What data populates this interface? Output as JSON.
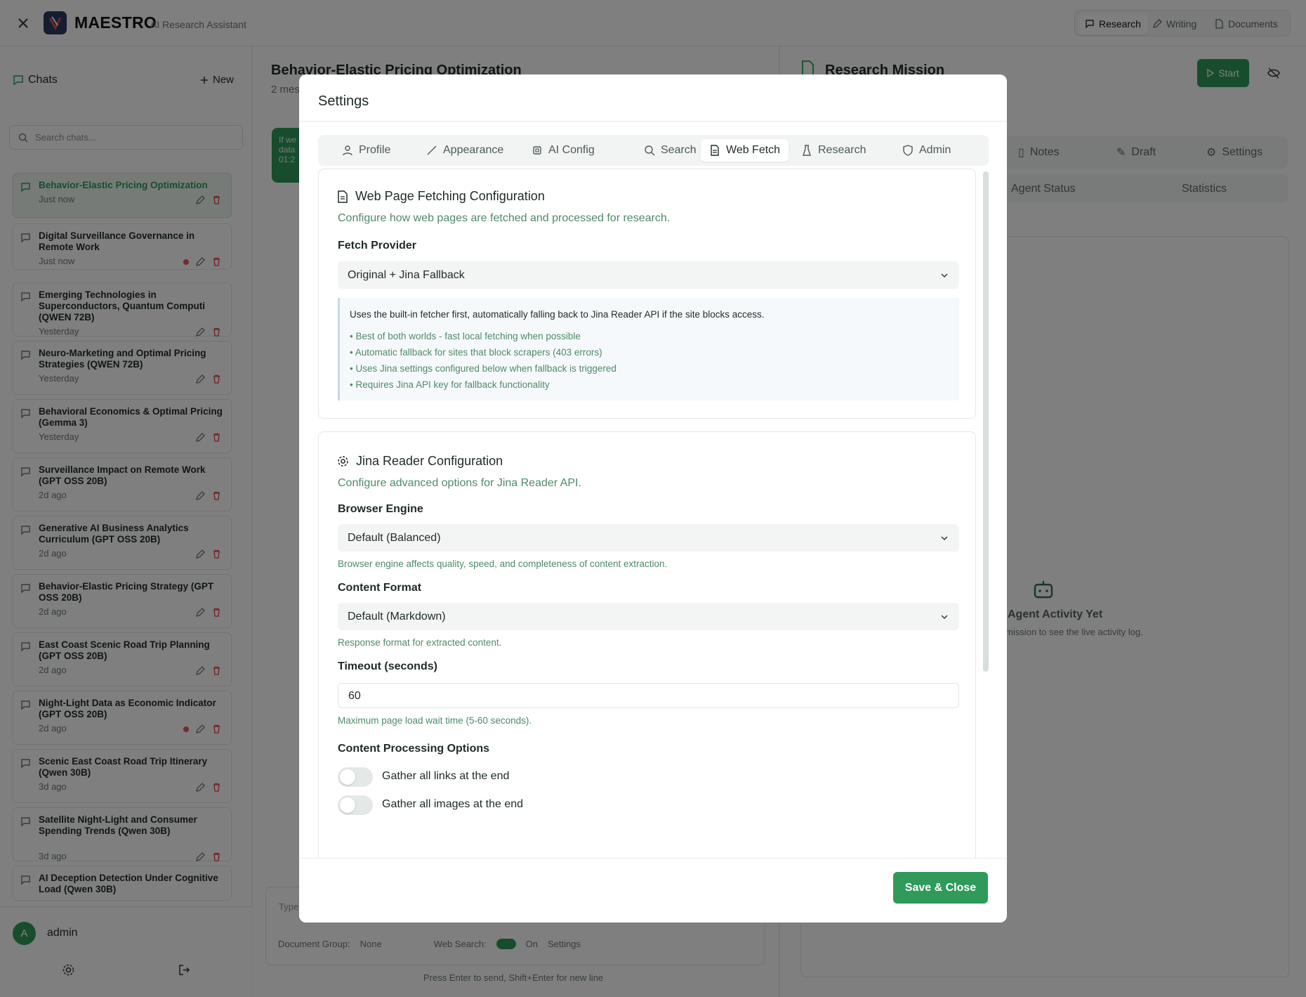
{
  "app": {
    "name": "MAESTRO",
    "subtitle": "AI Research Assistant"
  },
  "topnav": [
    {
      "label": "Research",
      "icon": "chat-icon"
    },
    {
      "label": "Writing",
      "icon": "pen-icon"
    },
    {
      "label": "Documents",
      "icon": "file-icon"
    }
  ],
  "sidebar": {
    "title": "Chats",
    "new_label": "New",
    "search_placeholder": "Search chats...",
    "items": [
      {
        "title": "Behavior-Elastic Pricing Optimization",
        "time": "Just now"
      },
      {
        "title": "Digital Surveillance Governance in Remote Work",
        "time": "Just now"
      },
      {
        "title": "Emerging Technologies in Superconductors, Quantum Computi (QWEN 72B)",
        "time": "Yesterday"
      },
      {
        "title": "Neuro-Marketing and Optimal Pricing Strategies (QWEN 72B)",
        "time": "Yesterday"
      },
      {
        "title": "Behavioral Economics & Optimal Pricing (Gemma 3)",
        "time": "Yesterday"
      },
      {
        "title": "Surveillance Impact on Remote Work (GPT OSS 20B)",
        "time": "2d ago"
      },
      {
        "title": "Generative AI Business Analytics Curriculum (GPT OSS 20B)",
        "time": "2d ago"
      },
      {
        "title": "Behavior-Elastic Pricing Strategy (GPT OSS 20B)",
        "time": "2d ago"
      },
      {
        "title": "East Coast Scenic Road Trip Planning (GPT OSS 20B)",
        "time": "2d ago"
      },
      {
        "title": "Night-Light Data as Economic Indicator (GPT OSS 20B)",
        "time": "2d ago"
      },
      {
        "title": "Scenic East Coast Road Trip Itinerary (Qwen 30B)",
        "time": "3d ago"
      },
      {
        "title": "Satellite Night-Light and Consumer Spending Trends (Qwen 30B)",
        "time": "3d ago"
      },
      {
        "title": "AI Deception Detection Under Cognitive Load (Qwen 30B)",
        "time": ""
      }
    ],
    "user": {
      "initial": "A",
      "name": "admin"
    }
  },
  "center": {
    "title": "Behavior-Elastic Pricing Optimization",
    "subtitle": "2 mes",
    "bubble_text": "If we data 01:2",
    "composer_placeholder": "Type",
    "document_group_label": "Document Group:",
    "document_group_value": "None",
    "web_search_label": "Web Search:",
    "web_search_state": "On",
    "settings_label": "Settings",
    "hint": "Press Enter to send, Shift+Enter for new line"
  },
  "right": {
    "title": "Research Mission",
    "start_label": "Start",
    "tabs": [
      "Notes",
      "Draft",
      "Settings"
    ],
    "subtabs": [
      "Agent Status",
      "Statistics"
    ],
    "empty_title": "Agent Activity Yet",
    "empty_desc": "mission to see the live activity log."
  },
  "modal": {
    "title": "Settings",
    "tabs": [
      {
        "label": "Profile",
        "icon": "user-icon"
      },
      {
        "label": "Appearance",
        "icon": "brush-icon"
      },
      {
        "label": "AI Config",
        "icon": "cpu-icon"
      },
      {
        "label": "Search",
        "icon": "search-icon"
      },
      {
        "label": "Web Fetch",
        "icon": "document-icon"
      },
      {
        "label": "Research",
        "icon": "flask-icon"
      },
      {
        "label": "Admin",
        "icon": "shield-icon"
      }
    ],
    "active_tab": "Web Fetch",
    "web_fetch": {
      "title": "Web Page Fetching Configuration",
      "desc": "Configure how web pages are fetched and processed for research.",
      "provider_label": "Fetch Provider",
      "provider_value": "Original + Jina Fallback",
      "note_title": "Uses the built-in fetcher first, automatically falling back to Jina Reader API if the site blocks access.",
      "note_bullets": [
        "• Best of both worlds - fast local fetching when possible",
        "• Automatic fallback for sites that block scrapers (403 errors)",
        "• Uses Jina settings configured below when fallback is triggered",
        "• Requires Jina API key for fallback functionality"
      ]
    },
    "jina": {
      "title": "Jina Reader Configuration",
      "desc": "Configure advanced options for Jina Reader API.",
      "engine_label": "Browser Engine",
      "engine_value": "Default (Balanced)",
      "engine_help": "Browser engine affects quality, speed, and completeness of content extraction.",
      "format_label": "Content Format",
      "format_value": "Default (Markdown)",
      "format_help": "Response format for extracted content.",
      "timeout_label": "Timeout (seconds)",
      "timeout_value": "60",
      "timeout_help": "Maximum page load wait time (5-60 seconds).",
      "processing_label": "Content Processing Options",
      "toggles": [
        {
          "label": "Gather all links at the end",
          "on": false
        },
        {
          "label": "Gather all images at the end",
          "on": false
        }
      ]
    },
    "save_label": "Save & Close"
  },
  "colors": {
    "accent": "#2f9a5a",
    "overlay": "rgba(0,0,0,0.5)",
    "link_green": "#4e8a69"
  }
}
